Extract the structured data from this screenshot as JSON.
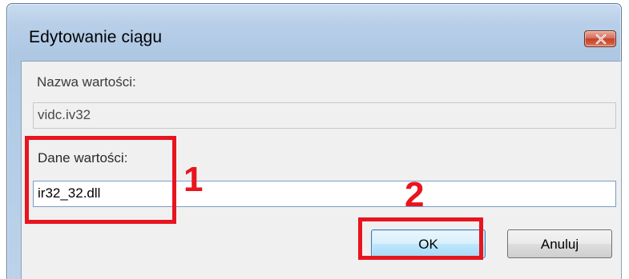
{
  "dialog": {
    "title": "Edytowanie ciągu",
    "close_icon": "close-icon"
  },
  "value_name": {
    "label": "Nazwa wartości:",
    "value": "vidc.iv32"
  },
  "value_data": {
    "label": "Dane wartości:",
    "value": "ir32_32.dll"
  },
  "buttons": {
    "ok_label": "OK",
    "cancel_label": "Anuluj"
  },
  "annotations": {
    "step_1": "1",
    "step_2": "2",
    "highlight_color": "#e8141e"
  },
  "colors": {
    "frame": "#b9cfe8",
    "client": "#f0f0f0",
    "close_button": "#c4432a",
    "ok_button_border": "#3c7fb1"
  }
}
